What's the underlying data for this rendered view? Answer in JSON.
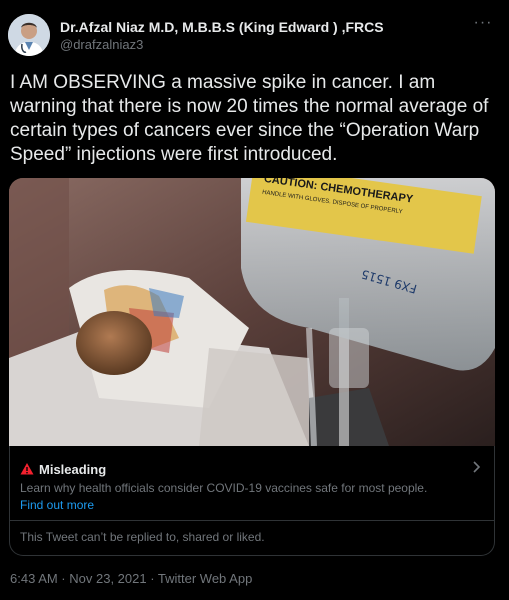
{
  "author": {
    "display_name": "Dr.Afzal Niaz M.D, M.B.B.S (King Edward ) ,FRCS",
    "handle": "@drafzalniaz3",
    "avatar_icon": "doctor-avatar-icon"
  },
  "menu": {
    "label": "···",
    "icon": "more-options-icon"
  },
  "tweet": {
    "text": "I AM OBSERVING a massive spike in cancer. I am warning that there is now 20 times the normal average of certain types of cancers ever since the “Operation Warp Speed” injections were first introduced."
  },
  "media": {
    "iv_bag_label": "CAUTION: CHEMOTHERAPY",
    "iv_bag_subtext": "HANDLE WITH GLOVES. DISPOSE OF PROPERLY",
    "iv_bag_handwriting": "FX9 1515"
  },
  "notice": {
    "title": "Misleading",
    "description": "Learn why health officials consider COVID-19 vaccines safe for most people.",
    "link": "Find out more",
    "reply_restriction": "This Tweet can’t be replied to, shared or liked."
  },
  "meta": {
    "timestamp": "6:43 AM · Nov 23, 2021 · Twitter Web App"
  },
  "colors": {
    "background": "#000000",
    "text_primary": "#e7e9ea",
    "text_secondary": "#71767b",
    "link": "#1d9bf0",
    "warning": "#f4212e",
    "border": "#2f3336"
  }
}
